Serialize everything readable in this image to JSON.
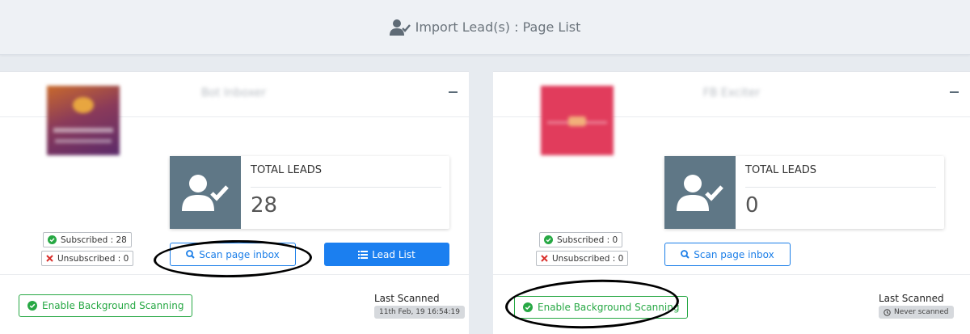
{
  "header": {
    "title": "Import Lead(s) : Page List",
    "icon": "user-check-icon"
  },
  "pages": [
    {
      "title": "Bot Inboxer",
      "subscribed": "Subscribed : 28",
      "unsubscribed": "Unsubscribed : 0",
      "total_leads_label": "TOTAL LEADS",
      "total_leads_value": "28",
      "scan_button": "Scan page inbox",
      "lead_list_button": "Lead List",
      "bg_scan_button": "Enable Background Scanning",
      "last_scanned_label": "Last Scanned",
      "last_scanned_value": "11th Feb, 19 16:54:19"
    },
    {
      "title": "FB Exciter",
      "subscribed": "Subscribed : 0",
      "unsubscribed": "Unsubscribed : 0",
      "total_leads_label": "TOTAL LEADS",
      "total_leads_value": "0",
      "scan_button": "Scan page inbox",
      "bg_scan_button": "Enable Background Scanning",
      "last_scanned_label": "Last Scanned",
      "last_scanned_value": "Never scanned"
    }
  ],
  "colors": {
    "primary": "#1b7ff0",
    "success": "#27a844",
    "danger": "#d9302c",
    "icon_bg": "#5f7786"
  }
}
